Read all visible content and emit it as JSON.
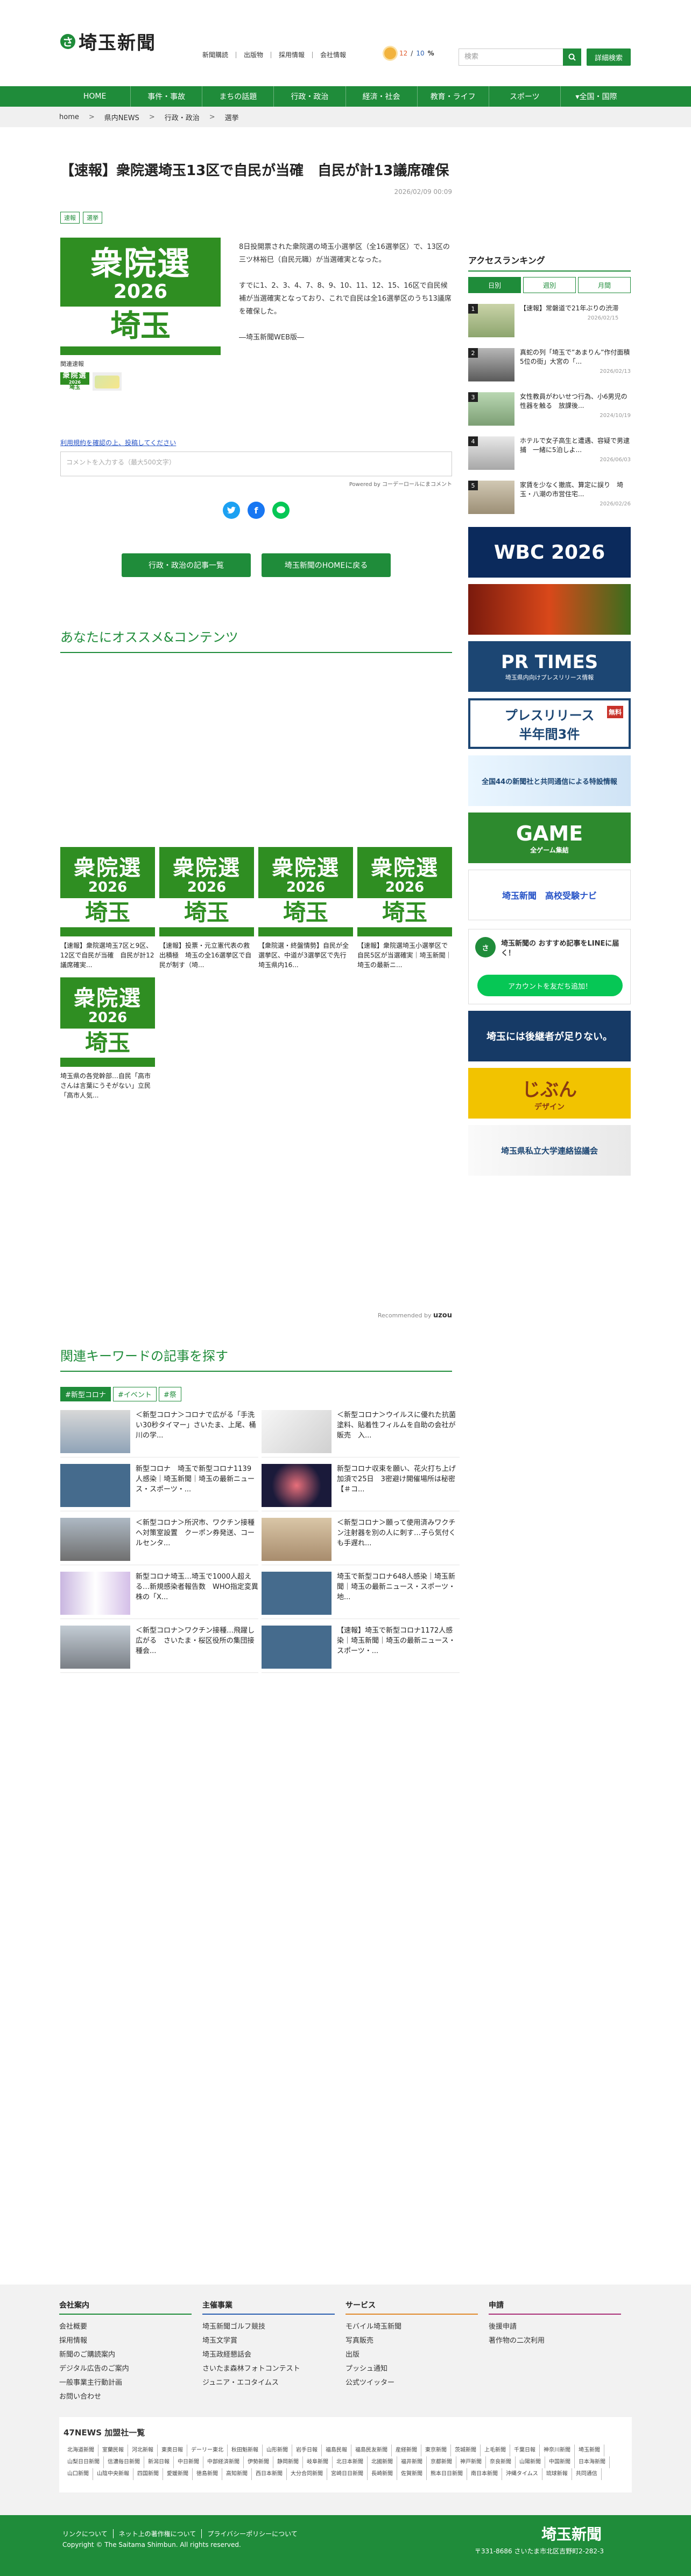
{
  "header": {
    "logo_text": "埼玉新聞",
    "top_links": [
      "新聞購読",
      "出版物",
      "採用情報",
      "会社情報"
    ],
    "weather_temp": "12",
    "weather_sep": "/",
    "weather_temp2": "10",
    "weather_unit": "%",
    "search_placeholder": "検索",
    "advanced_search": "詳細検索"
  },
  "nav": [
    "HOME",
    "事件・事故",
    "まちの話題",
    "行政・政治",
    "経済・社会",
    "教育・ライフ",
    "スポーツ",
    "▾全国・国際"
  ],
  "breadcrumb": [
    "home",
    ">",
    "県内NEWS",
    ">",
    "行政・政治",
    ">",
    "選挙"
  ],
  "article": {
    "title": "【速報】衆院選埼玉13区で自民が当確　自民が計13議席確保",
    "date": "2026/02/09 00:09",
    "tags": [
      "速報",
      "選挙"
    ],
    "image_text": {
      "line1": "衆院選",
      "line2": "2026",
      "line3": "埼玉"
    },
    "caption": "関連速報",
    "para1": "8日投開票された衆院選の埼玉小選挙区（全16選挙区）で、13区の三ツ林裕巳（自民元職）が当選確実となった。",
    "para2": "すでに1、2、3、4、7、8、9、10、11、12、15、16区で自民候補が当選確実となっており、これで自民は全16選挙区のうち13議席を確保した。",
    "para3": "―埼玉新聞WEB版―",
    "comment_link": "利用規約を確認の上、投稿してください",
    "comment_placeholder": "コメントを入力する（最大500文字）",
    "powered": "Powered by コーデーロールにまコメント",
    "btn_list": "行政・政治の記事一覧",
    "btn_home": "埼玉新聞のHOMEに戻る"
  },
  "recommend": {
    "title": "あなたにオススメ&コンテンツ",
    "cards": [
      "【速報】衆院選埼玉7区と9区、12区で自民が当確　自民が計12議席確実...",
      "【速報】投票・元立憲代表の救出積極　埼玉の全16選挙区で自民が制す（埼...",
      "【衆院選・終盤情勢】自民が全選挙区、中道が3選挙区で先行　埼玉県内16...",
      "【速報】衆院選埼玉小選挙区で自民5区が当選確実｜埼玉新聞｜埼玉の最新ニ...",
      "埼玉県の各党幹部…自民「高市さんは言葉にうそがない」立民「高市人気..."
    ],
    "rec_by": "Recommended by",
    "rec_brand": "uzou"
  },
  "keywords": {
    "title": "関連キーワードの記事を探す",
    "tabs": [
      "#新型コロナ",
      "#イベント",
      "#祭"
    ],
    "items": [
      "＜新型コロナ＞コロナで広がる「手洗い30秒タイマー」さいたま、上尾、桶川の学...",
      "＜新型コロナ＞ウイルスに優れた抗菌塗料、貼着性フィルムを自助の会社が販売　入...",
      "新型コロナ　埼玉で新型コロナ1139人感染｜埼玉新聞｜埼玉の最新ニュース・スポーツ・...",
      "新型コロナ収束を願い、花火打ち上げ　加須で25日　3密避け開催場所は秘密【＃コ...",
      "＜新型コロナ＞所沢市、ワクチン接種へ対策室設置　クーポン券発送、コールセンタ...",
      "＜新型コロナ＞願って使用済みワクチン注射器を別の人に刺す…子ら気付くも手遅れ...",
      "新型コロナ埼玉…埼玉で1000人超える…新規感染者報告数　WHO指定変異株の「X...",
      "埼玉で新型コロナ648人感染｜埼玉新聞｜埼玉の最新ニュース・スポーツ・地...",
      "＜新型コロナ＞ワクチン接種…飛躍し広がる　さいたま・桜区役所の集団接種会...",
      "【速報】埼玉で新型コロナ1172人感染｜埼玉新聞｜埼玉の最新ニュース・スポーツ・..."
    ]
  },
  "ranking": {
    "title": "アクセスランキング",
    "tabs": [
      "日別",
      "週別",
      "月間"
    ],
    "items": [
      {
        "num": "1",
        "text": "【速報】常磐道で21年ぶりの渋滞",
        "date": "2026/02/15"
      },
      {
        "num": "2",
        "text": "真蛇の列「埼玉で”あまりん”作付面積5位の街」大宮の「...",
        "date": "2026/02/13"
      },
      {
        "num": "3",
        "text": "女性教員がわいせつ行為、小6男児の性器を触る　放課後...",
        "date": "2024/10/19"
      },
      {
        "num": "4",
        "text": "ホテルで女子高生と遭遇、容疑で男逮捕　一緒に5泊しよ...",
        "date": "2026/06/03"
      },
      {
        "num": "5",
        "text": "家賃を少なく撤底、算定に誤り　埼玉・八潮の市営住宅...",
        "date": "2026/02/26"
      }
    ]
  },
  "sidebar_banners": {
    "wbc": "WBC 2026",
    "prtimes": "PR TIMES",
    "prtimes_sub": "埼玉県内向けプレスリリース情報",
    "press": "プレスリリース",
    "press_sub": "半年間3件",
    "press_badge": "無料",
    "kyodo": "全国44の新聞社と共同通信による特設情報",
    "game": "GAME",
    "game_sub": "全ゲーム集結",
    "koko": "埼玉新聞　高校受験ナビ",
    "line_title": "埼玉新聞の おすすめ記事をLINEに届く！",
    "line_btn": "アカウントを友だち追加！",
    "tranbi": "埼玉には後継者が足りない。",
    "jibun": "じぶん",
    "jibun_sub": "デザイン",
    "univ": "埼玉県私立大学連絡協議会"
  },
  "footer": {
    "cols": [
      {
        "title": "会社案内",
        "links": [
          "会社概要",
          "採用情報",
          "新聞のご購読案内",
          "デジタル広告のご案内",
          "一般事業主行動計画",
          "お問い合わせ"
        ]
      },
      {
        "title": "主催事業",
        "links": [
          "埼玉新聞ゴルフ競技",
          "埼玉文学賞",
          "埼玉政経懇話会",
          "さいたま森林フォトコンテスト",
          "ジュニア・エコタイムス"
        ]
      },
      {
        "title": "サービス",
        "links": [
          "モバイル埼玉新聞",
          "写真販売",
          "出版",
          "プッシュ通知",
          "公式ツイッター"
        ]
      },
      {
        "title": "申請",
        "links": [
          "後援申請",
          "著作物の二次利用"
        ]
      }
    ],
    "news47_title": "47NEWS 加盟社一覧",
    "papers": [
      "北海道新聞",
      "室蘭民報",
      "河北新報",
      "東奥日報",
      "デーリー東北",
      "秋田魁新報",
      "山形新聞",
      "岩手日報",
      "福島民報",
      "福島民友新聞",
      "産経新聞",
      "東京新聞",
      "茨城新聞",
      "上毛新聞",
      "千葉日報",
      "神奈川新聞",
      "埼玉新聞",
      "山梨日日新聞",
      "信濃毎日新聞",
      "新潟日報",
      "中日新聞",
      "中部経済新聞",
      "伊勢新聞",
      "静岡新聞",
      "岐阜新聞",
      "北日本新聞",
      "北國新聞",
      "福井新聞",
      "京都新聞",
      "神戸新聞",
      "奈良新聞",
      "山陽新聞",
      "中国新聞",
      "日本海新聞",
      "山口新聞",
      "山陰中央新報",
      "四国新聞",
      "愛媛新聞",
      "徳島新聞",
      "高知新聞",
      "西日本新聞",
      "大分合同新聞",
      "宮崎日日新聞",
      "長崎新聞",
      "佐賀新聞",
      "熊本日日新聞",
      "南日本新聞",
      "沖縄タイムス",
      "琉球新報",
      "共同通信"
    ],
    "bar_links": [
      "リンクについて",
      "ネット上の著作権について",
      "プライバシーポリシーについて"
    ],
    "copyright": "Copyright © The Saitama Shimbun. All rights reserved.",
    "bar_logo": "埼玉新聞",
    "address": "〒331-8686 さいたま市北区吉野町2-282-3"
  }
}
